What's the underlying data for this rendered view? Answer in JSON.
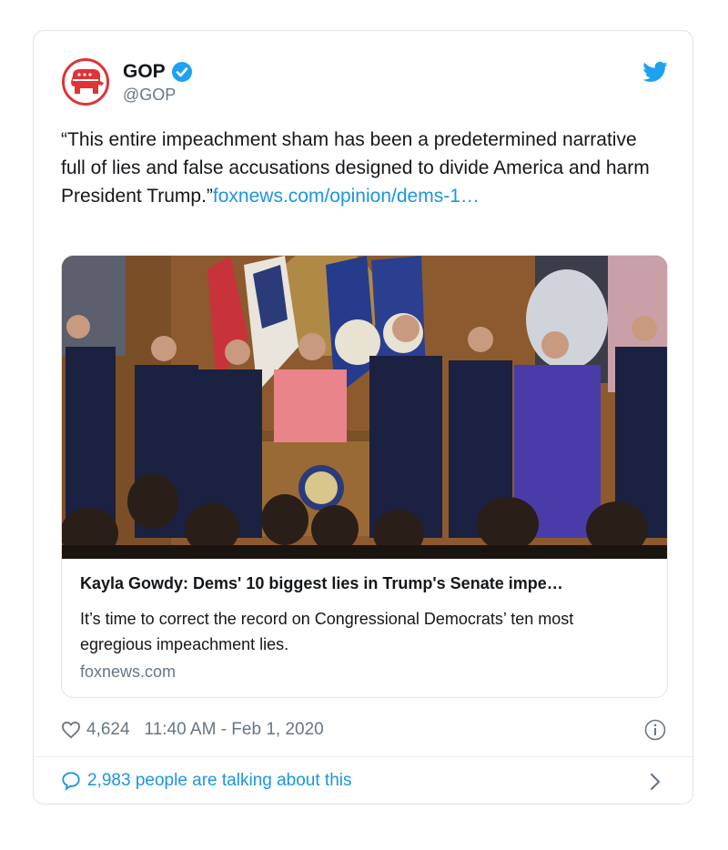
{
  "tweet": {
    "display_name": "GOP",
    "handle": "@GOP",
    "text": "“This entire impeachment sham has been a predetermined narrative full of lies and false accusations designed to divide America and harm President Trump.”",
    "link_text": "foxnews.com/opinion/dems-1…"
  },
  "link_card": {
    "title": "Kayla Gowdy: Dems' 10 biggest lies in Trump's Senate impe…",
    "description": "It’s time to correct the record on Congressional Democrats’ ten most egregious impeachment lies.",
    "domain": "foxnews.com"
  },
  "meta": {
    "likes": "4,624",
    "timestamp": "11:40 AM - Feb 1, 2020"
  },
  "footer": {
    "talking": "2,983 people are talking about this"
  },
  "icons": {
    "avatar": "gop-elephant-logo",
    "verified": "verified-badge-icon",
    "brand": "twitter-bird-icon",
    "like": "heart-icon",
    "info": "info-icon",
    "reply": "speech-bubble-icon",
    "chevron": "chevron-right-icon"
  },
  "colors": {
    "accent": "#1b95e0",
    "gop_red": "#e03336",
    "muted": "#657786"
  }
}
